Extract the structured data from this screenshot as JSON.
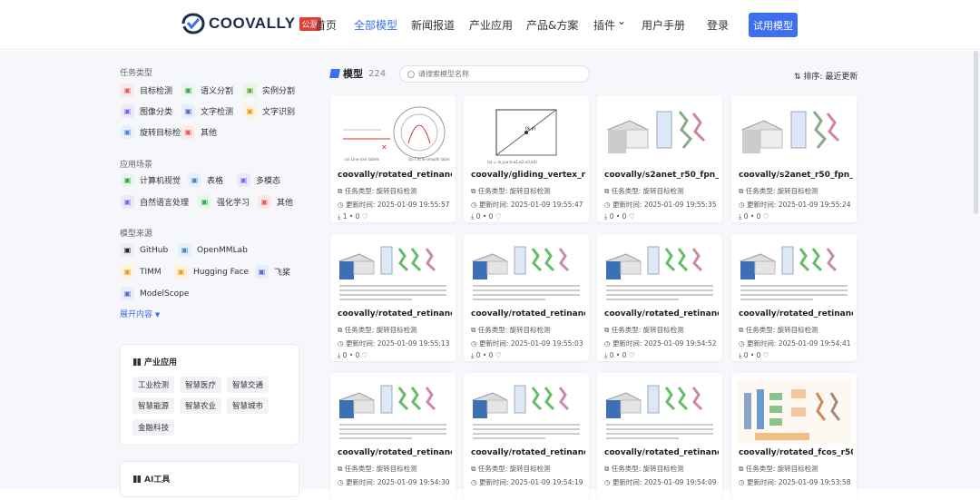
{
  "header": {
    "logo_text": "COOVALLY",
    "logo_badge": "公测",
    "nav": [
      "首页",
      "全部模型",
      "新闻报道",
      "产业应用",
      "产品&方案",
      "插件",
      "用户手册"
    ],
    "active_nav": "全部模型",
    "login": "登录",
    "try_button": "试用模型"
  },
  "sidebar": {
    "task_title": "任务类型",
    "tasks": [
      "目标检测",
      "语义分割",
      "实例分割",
      "图像分类",
      "文字检测",
      "文字识别",
      "旋转目标检测",
      "其他"
    ],
    "scene_title": "应用场景",
    "scenes": [
      "计算机视觉",
      "表格",
      "多模态",
      "自然语言处理",
      "强化学习",
      "其他"
    ],
    "source_title": "模型来源",
    "sources": [
      "GitHub",
      "OpenMMLab",
      "TIMM",
      "Hugging Face",
      "飞桨",
      "ModelScope"
    ],
    "expand": "展开内容",
    "industry_title": "产业应用",
    "industries": [
      "工业检测",
      "智慧医疗",
      "智慧交通",
      "智慧能源",
      "智慧农业",
      "智慧城市",
      "金融科技"
    ],
    "ai_tools_title": "AI工具"
  },
  "main": {
    "title": "模型",
    "count": "224",
    "search_placeholder": "请搜索模型名称",
    "sort_label": "排序: 最近更新",
    "cards": [
      {
        "name": "coovally/rotated_retinanet_...",
        "task": "任务类型: 旋转目标检测",
        "time": "更新时间: 2025-01-09 19:55:57",
        "stats": "1 • 0",
        "thumb": "circle"
      },
      {
        "name": "coovally/gliding_vertex_r50...",
        "task": "任务类型: 旋转目标检测",
        "time": "更新时间: 2025-01-09 19:55:47",
        "stats": "0 • 0",
        "thumb": "box"
      },
      {
        "name": "coovally/s2anet_r50_fpn_1x...",
        "task": "任务类型: 旋转目标检测",
        "time": "更新时间: 2025-01-09 19:55:35",
        "stats": "0 • 0",
        "thumb": "net"
      },
      {
        "name": "coovally/s2anet_r50_fpn_fp...",
        "task": "任务类型: 旋转目标检测",
        "time": "更新时间: 2025-01-09 19:55:24",
        "stats": "0 • 0",
        "thumb": "net"
      },
      {
        "name": "coovally/rotated_retinanet_...",
        "task": "任务类型: 旋转目标检测",
        "time": "更新时间: 2025-01-09 19:55:13",
        "stats": "0 • 0",
        "thumb": "fig"
      },
      {
        "name": "coovally/rotated_retinanet_...",
        "task": "任务类型: 旋转目标检测",
        "time": "更新时间: 2025-01-09 19:55:03",
        "stats": "0 • 0",
        "thumb": "fig"
      },
      {
        "name": "coovally/rotated_retinanet_...",
        "task": "任务类型: 旋转目标检测",
        "time": "更新时间: 2025-01-09 19:54:52",
        "stats": "0 • 0",
        "thumb": "fig"
      },
      {
        "name": "coovally/rotated_retinanet_...",
        "task": "任务类型: 旋转目标检测",
        "time": "更新时间: 2025-01-09 19:54:41",
        "stats": "0 • 0",
        "thumb": "fig"
      },
      {
        "name": "coovally/rotated_retinanet_...",
        "task": "任务类型: 旋转目标检测",
        "time": "更新时间: 2025-01-09 19:54:30",
        "stats": "",
        "thumb": "fig"
      },
      {
        "name": "coovally/rotated_retinanet_...",
        "task": "任务类型: 旋转目标检测",
        "time": "更新时间: 2025-01-09 19:54:19",
        "stats": "",
        "thumb": "fig"
      },
      {
        "name": "coovally/rotated_retinanet_...",
        "task": "任务类型: 旋转目标检测",
        "time": "更新时间: 2025-01-09 19:54:09",
        "stats": "",
        "thumb": "fig"
      },
      {
        "name": "coovally/rotated_fcos_r50_f...",
        "task": "任务类型: 旋转目标检测",
        "time": "更新时间: 2025-01-09 19:53:58",
        "stats": "",
        "thumb": "fcos"
      }
    ]
  }
}
